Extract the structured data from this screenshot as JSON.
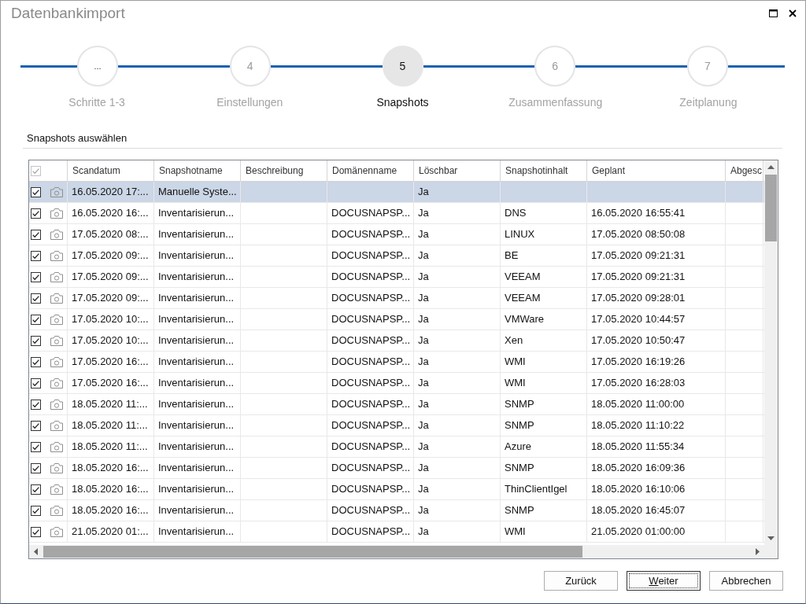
{
  "window": {
    "title": "Datenbankimport"
  },
  "steps": [
    {
      "number": "...",
      "label": "Schritte 1-3",
      "selected": false
    },
    {
      "number": "4",
      "label": "Einstellungen",
      "selected": false
    },
    {
      "number": "5",
      "label": "Snapshots",
      "selected": true
    },
    {
      "number": "6",
      "label": "Zusammenfassung",
      "selected": false
    },
    {
      "number": "7",
      "label": "Zeitplanung",
      "selected": false
    }
  ],
  "section": {
    "title": "Snapshots auswählen"
  },
  "table": {
    "select_all": {
      "checked": true,
      "disabled": true
    },
    "columns": [
      "Scandatum",
      "Snapshotname",
      "Beschreibung",
      "Domänenname",
      "Löschbar",
      "Snapshotinhalt",
      "Geplant",
      "Abgesc"
    ],
    "rows": [
      {
        "checked": true,
        "selected": true,
        "scan_date": "16.05.2020 17:...",
        "snapshot_name": "Manuelle Syste...",
        "deletable": "Ja"
      },
      {
        "checked": true,
        "selected": false,
        "scan_date": "16.05.2020 16:...",
        "snapshot_name": "Inventarisierun...",
        "domain_name": "DOCUSNAPSP...",
        "deletable": "Ja",
        "snapshot_content": "DNS",
        "scheduled": "16.05.2020 16:55:41"
      },
      {
        "checked": true,
        "selected": false,
        "scan_date": "17.05.2020 08:...",
        "snapshot_name": "Inventarisierun...",
        "domain_name": "DOCUSNAPSP...",
        "deletable": "Ja",
        "snapshot_content": "LINUX",
        "scheduled": "17.05.2020 08:50:08"
      },
      {
        "checked": true,
        "selected": false,
        "scan_date": "17.05.2020 09:...",
        "snapshot_name": "Inventarisierun...",
        "domain_name": "DOCUSNAPSP...",
        "deletable": "Ja",
        "snapshot_content": "BE",
        "scheduled": "17.05.2020 09:21:31"
      },
      {
        "checked": true,
        "selected": false,
        "scan_date": "17.05.2020 09:...",
        "snapshot_name": "Inventarisierun...",
        "domain_name": "DOCUSNAPSP...",
        "deletable": "Ja",
        "snapshot_content": "VEEAM",
        "scheduled": "17.05.2020 09:21:31"
      },
      {
        "checked": true,
        "selected": false,
        "scan_date": "17.05.2020 09:...",
        "snapshot_name": "Inventarisierun...",
        "domain_name": "DOCUSNAPSP...",
        "deletable": "Ja",
        "snapshot_content": "VEEAM",
        "scheduled": "17.05.2020 09:28:01"
      },
      {
        "checked": true,
        "selected": false,
        "scan_date": "17.05.2020 10:...",
        "snapshot_name": "Inventarisierun...",
        "domain_name": "DOCUSNAPSP...",
        "deletable": "Ja",
        "snapshot_content": "VMWare",
        "scheduled": "17.05.2020 10:44:57"
      },
      {
        "checked": true,
        "selected": false,
        "scan_date": "17.05.2020 10:...",
        "snapshot_name": "Inventarisierun...",
        "domain_name": "DOCUSNAPSP...",
        "deletable": "Ja",
        "snapshot_content": "Xen",
        "scheduled": "17.05.2020 10:50:47"
      },
      {
        "checked": true,
        "selected": false,
        "scan_date": "17.05.2020 16:...",
        "snapshot_name": "Inventarisierun...",
        "domain_name": "DOCUSNAPSP...",
        "deletable": "Ja",
        "snapshot_content": "WMI",
        "scheduled": "17.05.2020 16:19:26"
      },
      {
        "checked": true,
        "selected": false,
        "scan_date": "17.05.2020 16:...",
        "snapshot_name": "Inventarisierun...",
        "domain_name": "DOCUSNAPSP...",
        "deletable": "Ja",
        "snapshot_content": "WMI",
        "scheduled": "17.05.2020 16:28:03"
      },
      {
        "checked": true,
        "selected": false,
        "scan_date": "18.05.2020 11:...",
        "snapshot_name": "Inventarisierun...",
        "domain_name": "DOCUSNAPSP...",
        "deletable": "Ja",
        "snapshot_content": "SNMP",
        "scheduled": "18.05.2020 11:00:00"
      },
      {
        "checked": true,
        "selected": false,
        "scan_date": "18.05.2020 11:...",
        "snapshot_name": "Inventarisierun...",
        "domain_name": "DOCUSNAPSP...",
        "deletable": "Ja",
        "snapshot_content": "SNMP",
        "scheduled": "18.05.2020 11:10:22"
      },
      {
        "checked": true,
        "selected": false,
        "scan_date": "18.05.2020 11:...",
        "snapshot_name": "Inventarisierun...",
        "domain_name": "DOCUSNAPSP...",
        "deletable": "Ja",
        "snapshot_content": "Azure",
        "scheduled": "18.05.2020 11:55:34"
      },
      {
        "checked": true,
        "selected": false,
        "scan_date": "18.05.2020 16:...",
        "snapshot_name": "Inventarisierun...",
        "domain_name": "DOCUSNAPSP...",
        "deletable": "Ja",
        "snapshot_content": "SNMP",
        "scheduled": "18.05.2020 16:09:36"
      },
      {
        "checked": true,
        "selected": false,
        "scan_date": "18.05.2020 16:...",
        "snapshot_name": "Inventarisierun...",
        "domain_name": "DOCUSNAPSP...",
        "deletable": "Ja",
        "snapshot_content": "ThinClientIgel",
        "scheduled": "18.05.2020 16:10:06"
      },
      {
        "checked": true,
        "selected": false,
        "scan_date": "18.05.2020 16:...",
        "snapshot_name": "Inventarisierun...",
        "domain_name": "DOCUSNAPSP...",
        "deletable": "Ja",
        "snapshot_content": "SNMP",
        "scheduled": "18.05.2020 16:45:07"
      },
      {
        "checked": true,
        "selected": false,
        "scan_date": "21.05.2020 01:...",
        "snapshot_name": "Inventarisierun...",
        "domain_name": "DOCUSNAPSP...",
        "deletable": "Ja",
        "snapshot_content": "WMI",
        "scheduled": "21.05.2020 01:00:00"
      }
    ]
  },
  "buttons": [
    {
      "label": "Zurück",
      "focused": false
    },
    {
      "label": "Weiter",
      "focused": true
    },
    {
      "label": "Abbrechen",
      "focused": false
    }
  ]
}
